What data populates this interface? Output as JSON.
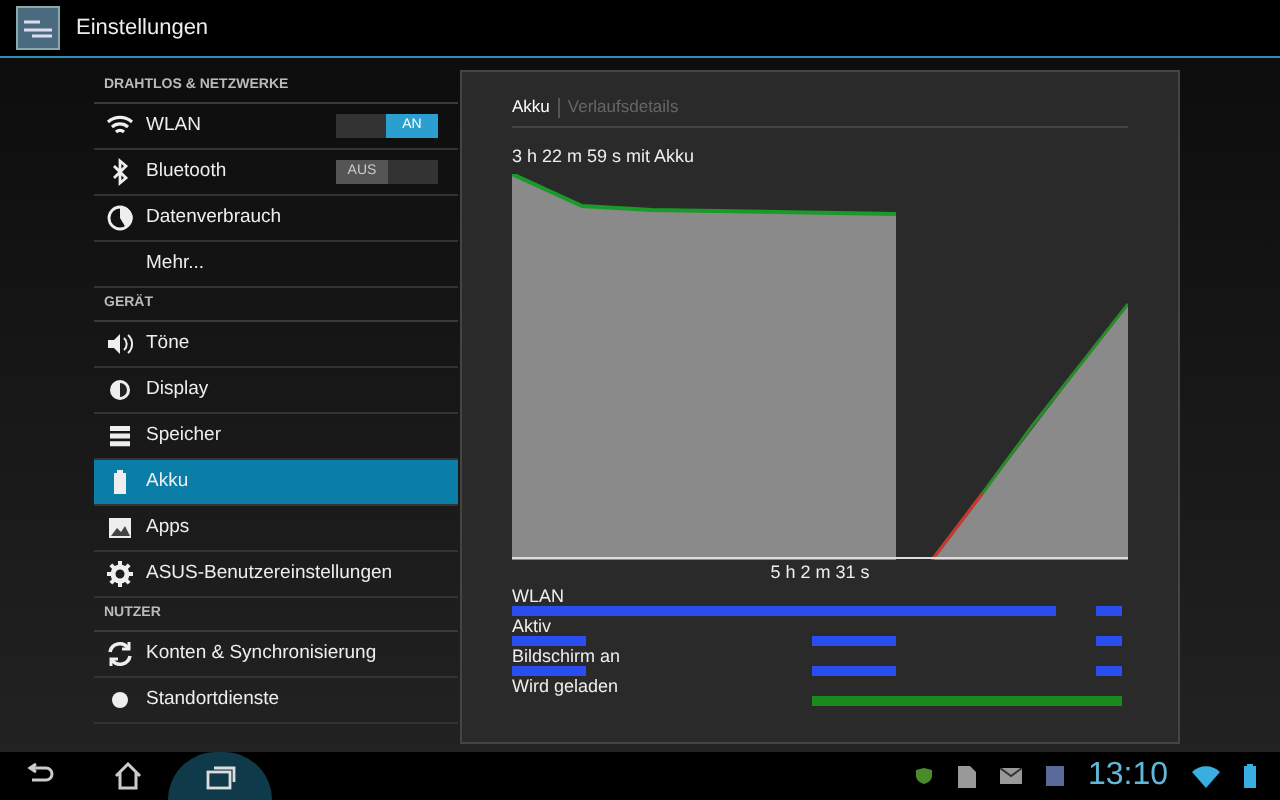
{
  "window": {
    "title": "Einstellungen"
  },
  "sidebar": {
    "sections": [
      {
        "header": "DRAHTLOS & NETZWERKE",
        "items": [
          {
            "label": "WLAN",
            "selected": false,
            "switch": {
              "on": true,
              "label": "AN"
            }
          },
          {
            "label": "Bluetooth",
            "selected": false,
            "switch": {
              "on": false,
              "label": "AUS"
            }
          },
          {
            "label": "Datenverbrauch",
            "selected": false
          },
          {
            "label": "Mehr...",
            "selected": false
          }
        ]
      },
      {
        "header": "GERÄT",
        "items": [
          {
            "label": "Töne",
            "selected": false
          },
          {
            "label": "Display",
            "selected": false
          },
          {
            "label": "Speicher",
            "selected": false
          },
          {
            "label": "Akku",
            "selected": true
          },
          {
            "label": "Apps",
            "selected": false
          },
          {
            "label": "ASUS-Benutzereinstellungen",
            "selected": false
          }
        ]
      },
      {
        "header": "NUTZER",
        "items": [
          {
            "label": "Konten & Synchronisierung",
            "selected": false
          },
          {
            "label": "Standortdienste",
            "selected": false
          }
        ]
      }
    ]
  },
  "panel": {
    "tabs": [
      {
        "label": "Akku",
        "selected": true
      },
      {
        "label": "Verlaufsdetails",
        "selected": false
      }
    ],
    "chart_title": "3 h 22 m 59 s mit Akku",
    "chart_caption": "5 h 2 m 31 s",
    "timelines": [
      {
        "label": "WLAN"
      },
      {
        "label": "Aktiv"
      },
      {
        "label": "Bildschirm an"
      },
      {
        "label": "Wird geladen"
      }
    ]
  },
  "status_bar": {
    "time": "13:10"
  }
}
